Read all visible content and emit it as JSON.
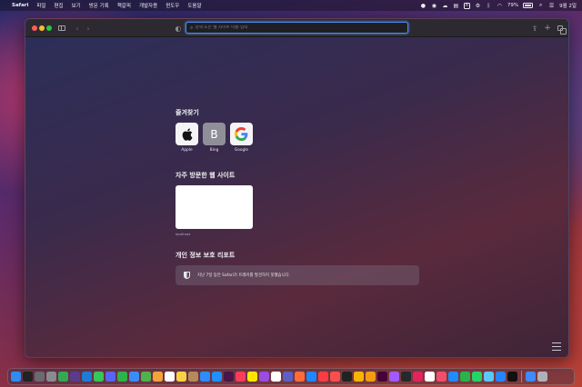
{
  "menubar": {
    "app_name": "Safari",
    "items": [
      "파일",
      "편집",
      "보기",
      "방문 기록",
      "책갈피",
      "개발자용",
      "윈도우",
      "도움말"
    ],
    "battery": "79%",
    "clock": "9월 2일"
  },
  "toolbar": {
    "address_placeholder": "검색 또는 웹 사이트 이름 입력"
  },
  "start_page": {
    "favorites_title": "즐겨찾기",
    "favorites": [
      {
        "label": "Apple",
        "icon": "apple-logo-icon"
      },
      {
        "label": "Bing",
        "icon": "bing-letter-icon",
        "letter": "B"
      },
      {
        "label": "Google",
        "icon": "google-logo-icon"
      }
    ],
    "frequent_title": "자주 방문한 웹 사이트",
    "frequent_sites": [
      {
        "label": "localhost"
      }
    ],
    "privacy_title": "개인 정보 보호 리포트",
    "privacy_text": "지난 7일 동안 Safari가 트래커를 발견하지 못했습니다."
  },
  "colors": {
    "accent": "#4d8bf5",
    "window_bg": "#2c2a30"
  },
  "dock": {
    "apps": [
      {
        "name": "finder-icon",
        "color": "#2f8cf0"
      },
      {
        "name": "terminal-icon",
        "color": "#222222"
      },
      {
        "name": "launchpad-icon",
        "color": "#6a6a70"
      },
      {
        "name": "system-preferences-icon",
        "color": "#8a8a90"
      },
      {
        "name": "chrome-icon",
        "color": "#34a853"
      },
      {
        "name": "github-desktop-icon",
        "color": "#5b3c8c"
      },
      {
        "name": "vscode-icon",
        "color": "#1e7bd6"
      },
      {
        "name": "messages-icon",
        "color": "#34c759"
      },
      {
        "name": "discord-icon",
        "color": "#5865f2"
      },
      {
        "name": "facetime-icon",
        "color": "#2bb44a"
      },
      {
        "name": "mail-icon",
        "color": "#3a8df5"
      },
      {
        "name": "maps-icon",
        "color": "#4fb24c"
      },
      {
        "name": "photos-icon",
        "color": "#f2a33a"
      },
      {
        "name": "calendar-icon",
        "color": "#ffffff"
      },
      {
        "name": "notes-icon",
        "color": "#f7d046"
      },
      {
        "name": "contacts-icon",
        "color": "#b58a5a"
      },
      {
        "name": "zoom-icon",
        "color": "#2d8cff"
      },
      {
        "name": "safari-icon",
        "color": "#1e90ff"
      },
      {
        "name": "slack-icon",
        "color": "#4a154b"
      },
      {
        "name": "music-icon",
        "color": "#fa3c5a"
      },
      {
        "name": "kakaotalk-icon",
        "color": "#fee500"
      },
      {
        "name": "podcasts-icon",
        "color": "#9b4de0"
      },
      {
        "name": "notion-icon",
        "color": "#ffffff"
      },
      {
        "name": "teams-icon",
        "color": "#5b5fc7"
      },
      {
        "name": "postman-icon",
        "color": "#ff6c37"
      },
      {
        "name": "app-store-icon",
        "color": "#1e88ff"
      },
      {
        "name": "music-note-icon",
        "color": "#fc3c44"
      },
      {
        "name": "news-icon",
        "color": "#f94f4f"
      },
      {
        "name": "tv-icon",
        "color": "#222222"
      },
      {
        "name": "sketch-icon",
        "color": "#f7b500"
      },
      {
        "name": "pages-icon",
        "color": "#f39c12"
      },
      {
        "name": "xd-icon",
        "color": "#470137"
      },
      {
        "name": "figma-icon",
        "color": "#a259ff"
      },
      {
        "name": "github-icon",
        "color": "#24292e"
      },
      {
        "name": "intellij-icon",
        "color": "#e0245e"
      },
      {
        "name": "reminders-icon",
        "color": "#ffffff"
      },
      {
        "name": "shortcuts-icon",
        "color": "#f04e6a"
      },
      {
        "name": "keynote-icon",
        "color": "#1e8cff"
      },
      {
        "name": "numbers-icon",
        "color": "#2bb24c"
      },
      {
        "name": "whatsapp-icon",
        "color": "#25d366"
      },
      {
        "name": "preview-icon",
        "color": "#5ac8fa"
      },
      {
        "name": "sourcetree-icon",
        "color": "#2684ff"
      },
      {
        "name": "activity-monitor-icon",
        "color": "#111111"
      },
      {
        "name": "downloads-icon",
        "color": "#3d8bff"
      },
      {
        "name": "trash-icon",
        "color": "#b0b0b8"
      }
    ]
  }
}
